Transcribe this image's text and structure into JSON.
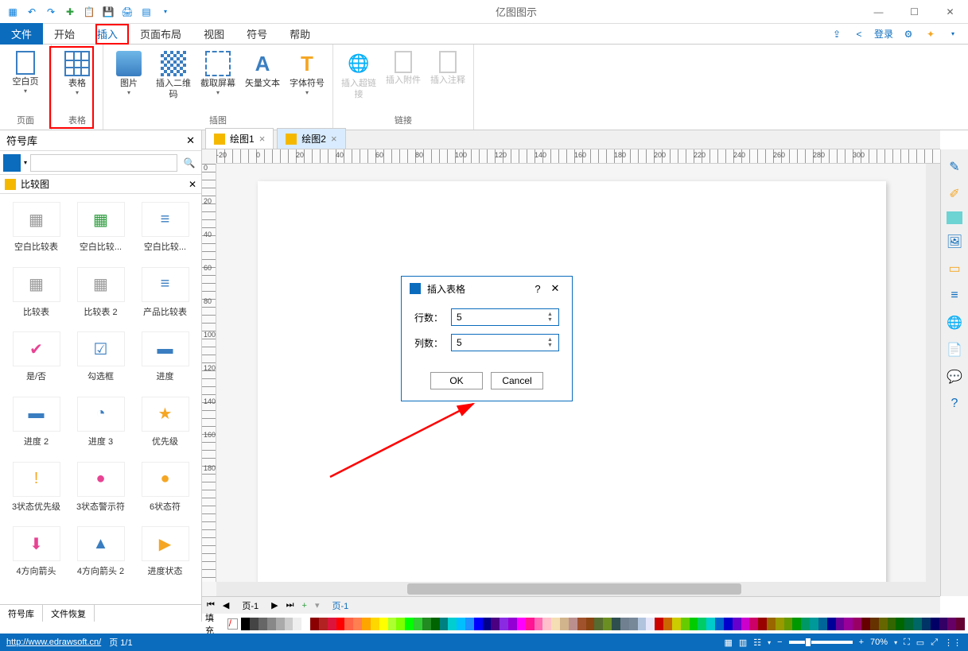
{
  "app": {
    "title": "亿图图示"
  },
  "qat_icons": [
    "app",
    "undo",
    "redo",
    "new",
    "paste",
    "save",
    "print",
    "export"
  ],
  "menu": {
    "items": [
      "文件",
      "开始",
      "插入",
      "页面布局",
      "视图",
      "符号",
      "帮助"
    ],
    "active_index": 2
  },
  "menubar_right": {
    "login": "登录"
  },
  "ribbon": {
    "groups": [
      {
        "label": "页面",
        "buttons": [
          {
            "label": "空白页",
            "icon": "blank-page"
          }
        ]
      },
      {
        "label": "表格",
        "buttons": [
          {
            "label": "表格",
            "icon": "table"
          }
        ]
      },
      {
        "label": "插图",
        "buttons": [
          {
            "label": "图片",
            "icon": "picture"
          },
          {
            "label": "插入二维码",
            "icon": "qrcode"
          },
          {
            "label": "截取屏幕",
            "icon": "screenshot"
          },
          {
            "label": "矢量文本",
            "icon": "vector-text"
          },
          {
            "label": "字体符号",
            "icon": "font-symbol"
          }
        ]
      },
      {
        "label": "链接",
        "buttons": [
          {
            "label": "插入超链接",
            "icon": "hyperlink",
            "disabled": true
          },
          {
            "label": "插入附件",
            "icon": "attachment",
            "disabled": true
          },
          {
            "label": "插入注释",
            "icon": "note",
            "disabled": true
          }
        ]
      }
    ]
  },
  "leftpanel": {
    "title": "符号库",
    "category": "比较图",
    "tabs": [
      "符号库",
      "文件恢复"
    ],
    "items": [
      {
        "label": "空白比较表"
      },
      {
        "label": "空白比较..."
      },
      {
        "label": "空白比较..."
      },
      {
        "label": "比较表"
      },
      {
        "label": "比较表 2"
      },
      {
        "label": "产品比较表"
      },
      {
        "label": "是/否"
      },
      {
        "label": "勾选框"
      },
      {
        "label": "进度"
      },
      {
        "label": "进度 2"
      },
      {
        "label": "进度 3"
      },
      {
        "label": "优先级"
      },
      {
        "label": "3状态优先级"
      },
      {
        "label": "3状态警示符"
      },
      {
        "label": "6状态符"
      },
      {
        "label": "4方向箭头"
      },
      {
        "label": "4方向箭头 2"
      },
      {
        "label": "进度状态"
      }
    ]
  },
  "doctabs": [
    {
      "label": "绘图1",
      "active": false
    },
    {
      "label": "绘图2",
      "active": true
    }
  ],
  "dialog": {
    "title": "插入表格",
    "rows_label": "行数：",
    "cols_label": "列数：",
    "rows_value": "5",
    "cols_value": "5",
    "ok": "OK",
    "cancel": "Cancel"
  },
  "pagebar": {
    "label1": "页-1",
    "label2": "页-1"
  },
  "colorbar": {
    "label": "填充"
  },
  "statusbar": {
    "url": "http://www.edrawsoft.cn/",
    "page": "页 1/1",
    "zoom": "70%"
  },
  "ruler_h": [
    "-20",
    "0",
    "20",
    "40",
    "60",
    "80",
    "100",
    "120",
    "140",
    "160",
    "180",
    "200",
    "220",
    "240",
    "260",
    "280",
    "300"
  ],
  "ruler_v": [
    "0",
    "20",
    "40",
    "60",
    "80",
    "100",
    "120",
    "140",
    "160",
    "180"
  ]
}
